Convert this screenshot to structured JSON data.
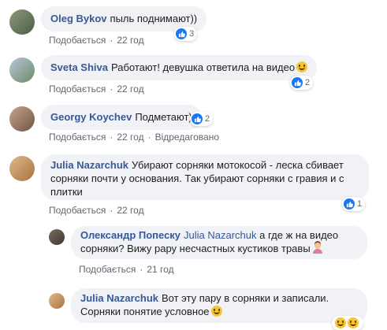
{
  "comments": [
    {
      "author": "Oleg Bykov",
      "text": "пыль поднимают))",
      "like_label": "Подобається",
      "time": "22 год",
      "reactions": "3"
    },
    {
      "author": "Sveta Shiva",
      "text": "Работают! девушка ответила на видео",
      "like_label": "Подобається",
      "time": "22 год",
      "reactions": "2",
      "emoji": "grinning-face"
    },
    {
      "author": "Georgy Koychev",
      "text": "Подметают)",
      "like_label": "Подобається",
      "time": "22 год",
      "edited": "Відредаговано",
      "reactions": "2"
    },
    {
      "author": "Julia Nazarchuk",
      "text": "Убирают сорняки мотокосой - леска сбивает сорняки почти у основания. Так убирают сорняки с гравия и с плитки",
      "like_label": "Подобається",
      "time": "22 год",
      "reactions": "1"
    }
  ],
  "replies": [
    {
      "author": "Олександр Попеску",
      "mention": "Julia Nazarchuk",
      "text": "а где ж на видео сорняки? Вижу рару несчастных кустиков травы",
      "like_label": "Подобається",
      "time": "21 год",
      "emoji": "person-shrugging"
    },
    {
      "author": "Julia Nazarchuk",
      "text": "Вот эту пару в сорняки и записали. Сорняки понятие условное",
      "emoji": "grinning-face"
    }
  ],
  "colors": {
    "link": "#385898",
    "bubble": "#f0f2f5",
    "like_blue": "#1877f2",
    "meta": "#606770"
  }
}
